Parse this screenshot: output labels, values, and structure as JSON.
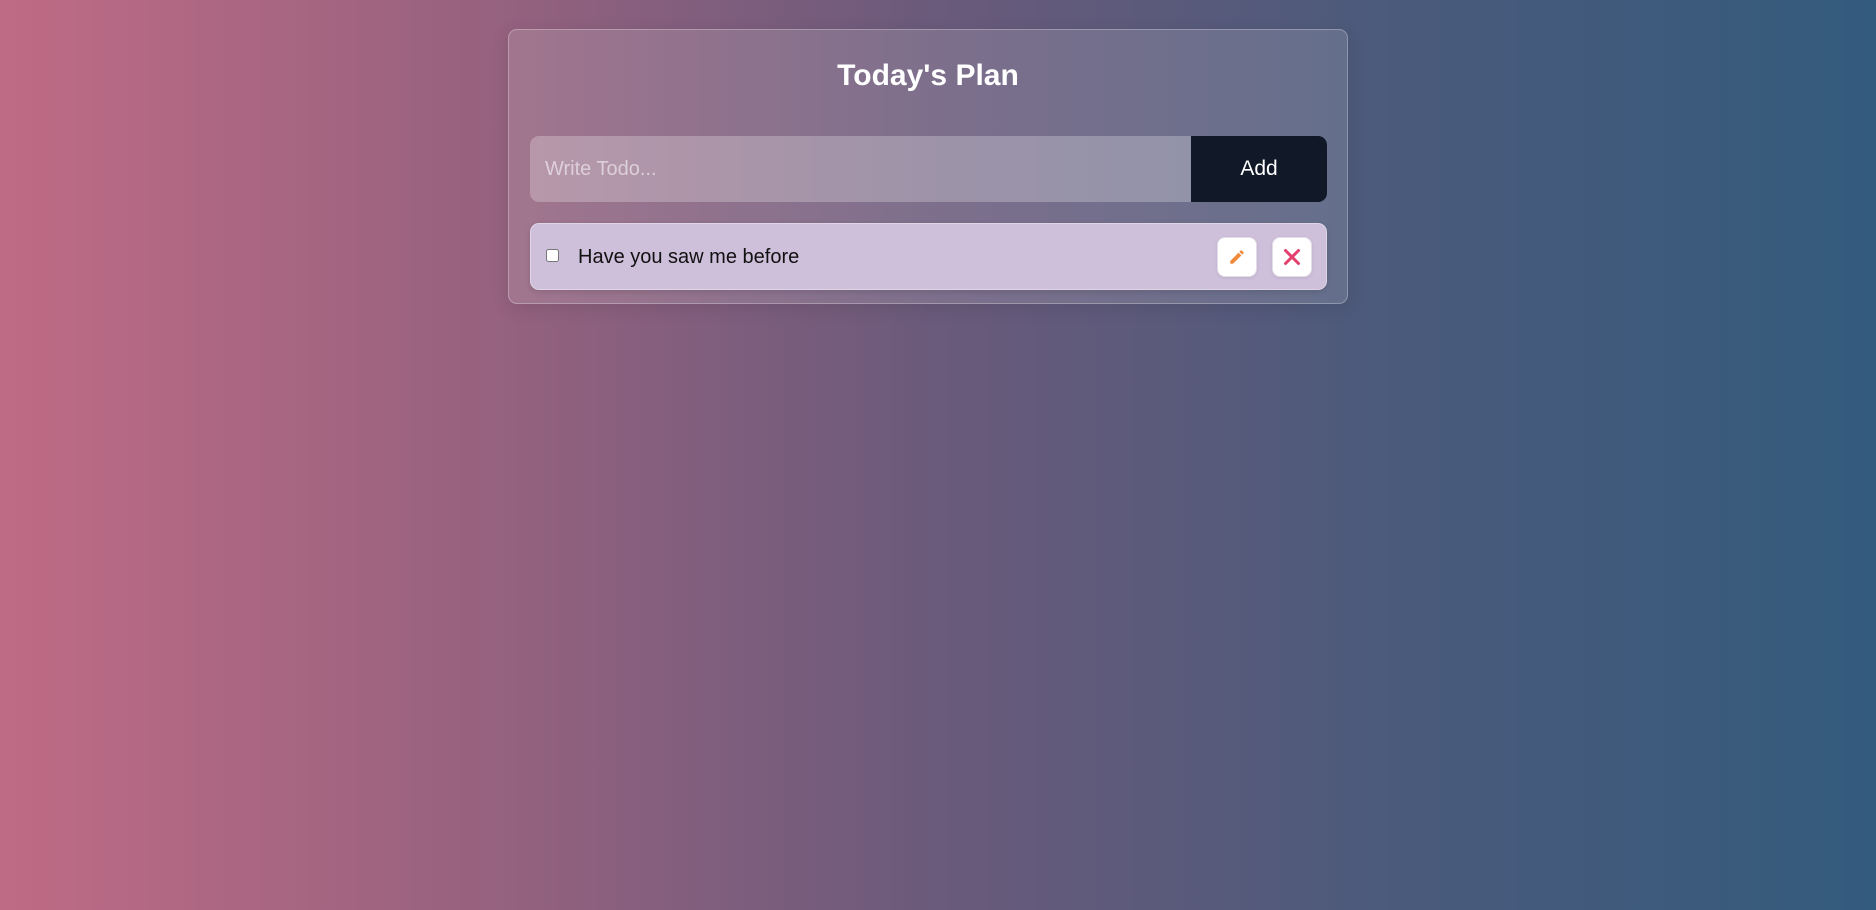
{
  "header": {
    "title": "Today's Plan"
  },
  "new_todo": {
    "placeholder": "Write Todo...",
    "value": "",
    "add_label": "Add"
  },
  "todos": [
    {
      "text": "Have you saw me before",
      "completed": false,
      "edit_icon": "pencil-icon",
      "delete_icon": "close-icon"
    }
  ],
  "colors": {
    "add_button_bg": "#111827",
    "todo_item_bg": "#cebfda",
    "edit_icon": "#f08a3b",
    "delete_icon": "#e4406f",
    "background_left": "#bf6b85",
    "background_right": "#335b7d"
  }
}
